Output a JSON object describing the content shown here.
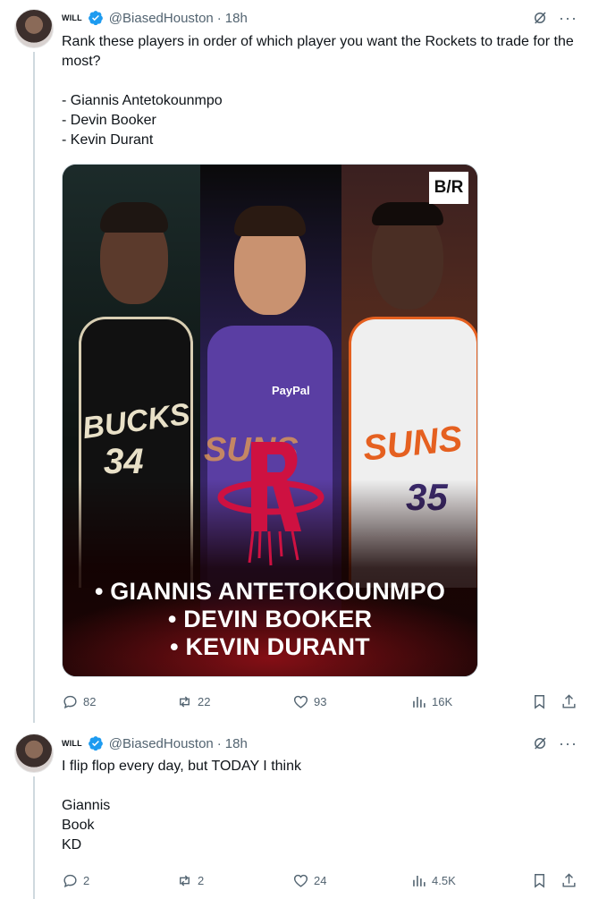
{
  "tweet1": {
    "author_name": "WILL",
    "handle": "@BiasedHouston",
    "separator": "·",
    "time": "18h",
    "text": "Rank these players in order of which player you want the Rockets to trade for the most?\n\n- Giannis Antetokounmpo\n- Devin Booker\n- Kevin Durant",
    "media": {
      "watermark": "B/R",
      "jersey_texts": {
        "bucks": "BUCKS",
        "bucks_number": "34",
        "booker_sponsor": "PayPal",
        "booker_team": "SUNS",
        "durant_team": "SUNS",
        "durant_number": "35"
      },
      "caption_lines": [
        "• GIANNIS ANTETOKOUNMPO",
        "• DEVIN BOOKER",
        "• KEVIN DURANT"
      ]
    },
    "stats": {
      "replies": "82",
      "reposts": "22",
      "likes": "93",
      "views": "16K"
    }
  },
  "tweet2": {
    "author_name": "WILL",
    "handle": "@BiasedHouston",
    "separator": "·",
    "time": "18h",
    "text": "I flip flop every day, but TODAY I think\n\nGiannis\nBook\nKD",
    "stats": {
      "replies": "2",
      "reposts": "2",
      "likes": "24",
      "views": "4.5K"
    }
  },
  "colors": {
    "accent": "#1d9bf0",
    "muted": "#536471",
    "text": "#0f1419",
    "rockets_red": "#ce1141"
  },
  "icons": [
    "verified-badge-icon",
    "grok-icon",
    "more-icon",
    "reply-icon",
    "repost-icon",
    "like-icon",
    "views-icon",
    "bookmark-icon",
    "share-icon"
  ]
}
